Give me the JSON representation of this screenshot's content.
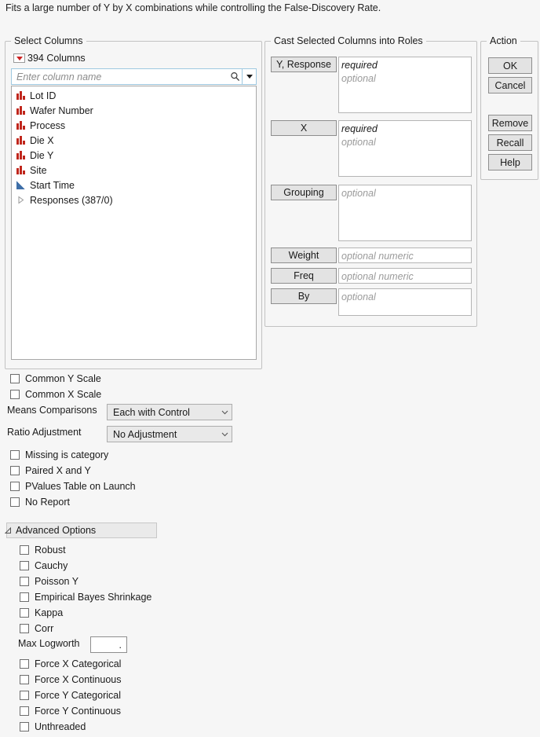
{
  "description": "Fits a large number of Y by X combinations while controlling the False-Discovery Rate.",
  "select_columns": {
    "group_title": "Select Columns",
    "column_count_label": "394 Columns",
    "search_placeholder": "Enter column name",
    "search_value": "",
    "search_icon": "search-icon",
    "dropdown_icon": "chevron-down-icon",
    "columns": [
      {
        "label": "Lot ID",
        "icon": "nominal-bars-icon"
      },
      {
        "label": "Wafer Number",
        "icon": "nominal-bars-icon"
      },
      {
        "label": "Process",
        "icon": "nominal-bars-icon"
      },
      {
        "label": "Die X",
        "icon": "nominal-bars-icon"
      },
      {
        "label": "Die Y",
        "icon": "nominal-bars-icon"
      },
      {
        "label": "Site",
        "icon": "nominal-bars-icon"
      },
      {
        "label": "Start Time",
        "icon": "continuous-triangle-icon"
      },
      {
        "label": "Responses (387/0)",
        "icon": "disclosure-triangle-icon"
      }
    ]
  },
  "cast_roles": {
    "group_title": "Cast Selected Columns into Roles",
    "roles": [
      {
        "button": "Y, Response",
        "required": "required",
        "optional": "optional"
      },
      {
        "button": "X",
        "required": "required",
        "optional": "optional"
      },
      {
        "button": "Grouping",
        "required": "",
        "optional": "optional"
      },
      {
        "button": "Weight",
        "required": "",
        "optional": "optional numeric"
      },
      {
        "button": "Freq",
        "required": "",
        "optional": "optional numeric"
      },
      {
        "button": "By",
        "required": "",
        "optional": "optional"
      }
    ]
  },
  "action": {
    "group_title": "Action",
    "buttons": [
      {
        "label": "OK"
      },
      {
        "label": "Cancel"
      },
      {
        "label": "Remove"
      },
      {
        "label": "Recall"
      },
      {
        "label": "Help"
      }
    ]
  },
  "options": {
    "common_y_scale": {
      "label": "Common Y Scale",
      "checked": false
    },
    "common_x_scale": {
      "label": "Common X Scale",
      "checked": false
    },
    "means_comparisons": {
      "label": "Means Comparisons",
      "value": "Each with Control",
      "chevron": "chevron-down-icon"
    },
    "ratio_adjustment": {
      "label": "Ratio Adjustment",
      "value": "No Adjustment",
      "chevron": "chevron-down-icon"
    },
    "missing_is_category": {
      "label": "Missing is category",
      "checked": false
    },
    "paired_x_and_y": {
      "label": "Paired X and Y",
      "checked": false
    },
    "pvalues_table_on_launch": {
      "label": "PValues Table on Launch",
      "checked": false
    },
    "no_report": {
      "label": "No Report",
      "checked": false
    }
  },
  "advanced_options": {
    "header_label": "Advanced Options",
    "expanded": true,
    "checkboxes": [
      {
        "label": "Robust",
        "checked": false
      },
      {
        "label": "Cauchy",
        "checked": false
      },
      {
        "label": "Poisson Y",
        "checked": false
      },
      {
        "label": "Empirical Bayes Shrinkage",
        "checked": false
      },
      {
        "label": "Kappa",
        "checked": false
      },
      {
        "label": "Corr",
        "checked": false
      }
    ],
    "max_logworth": {
      "label": "Max Logworth",
      "value": "."
    },
    "force_checkboxes": [
      {
        "label": "Force X Categorical",
        "checked": false
      },
      {
        "label": "Force X Continuous",
        "checked": false
      },
      {
        "label": "Force Y Categorical",
        "checked": false
      },
      {
        "label": "Force Y Continuous",
        "checked": false
      },
      {
        "label": "Unthreaded",
        "checked": false
      }
    ]
  }
}
